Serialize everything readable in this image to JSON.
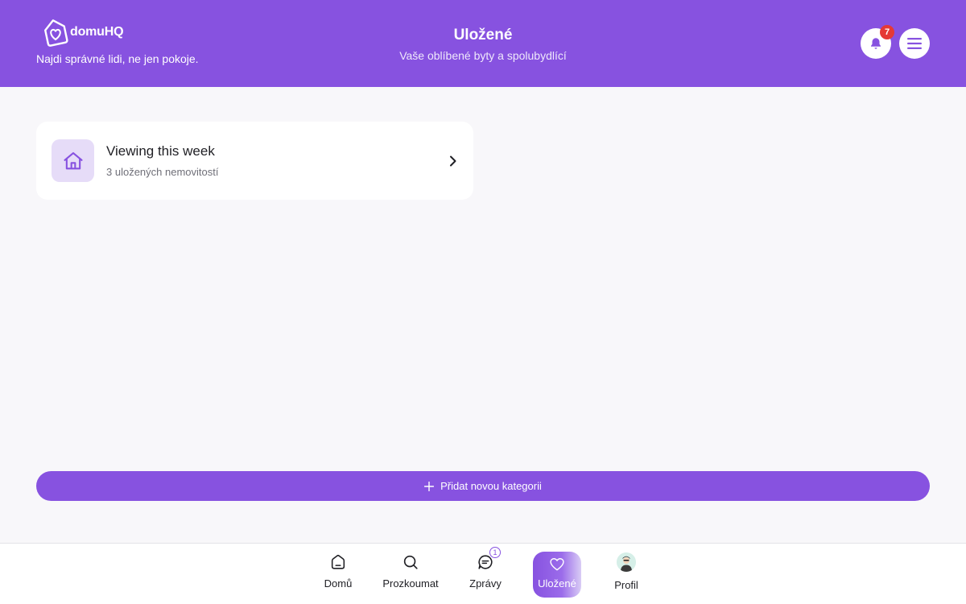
{
  "header": {
    "logo_text": "domuHQ",
    "tagline": "Najdi správné lidi, ne jen pokoje.",
    "title": "Uložené",
    "subtitle": "Vaše oblíbené byty a spolubydlící",
    "notification_count": "7",
    "bell_icon": "bell-icon",
    "menu_icon": "hamburger-menu-icon",
    "accent_color": "#8752e0"
  },
  "categories": [
    {
      "title": "Viewing this week",
      "subtitle": "3 uložených nemovitostí",
      "icon": "house-icon"
    }
  ],
  "add_category": {
    "label": "Přidat novou kategorii",
    "icon": "plus-icon"
  },
  "bottom_nav": {
    "items": [
      {
        "label": "Domů",
        "icon": "home-icon"
      },
      {
        "label": "Prozkoumat",
        "icon": "search-icon"
      },
      {
        "label": "Zprávy",
        "icon": "chat-icon",
        "badge": "1"
      },
      {
        "label": "Uložené",
        "icon": "heart-icon",
        "active": true
      },
      {
        "label": "Profil",
        "icon": "avatar"
      }
    ]
  }
}
